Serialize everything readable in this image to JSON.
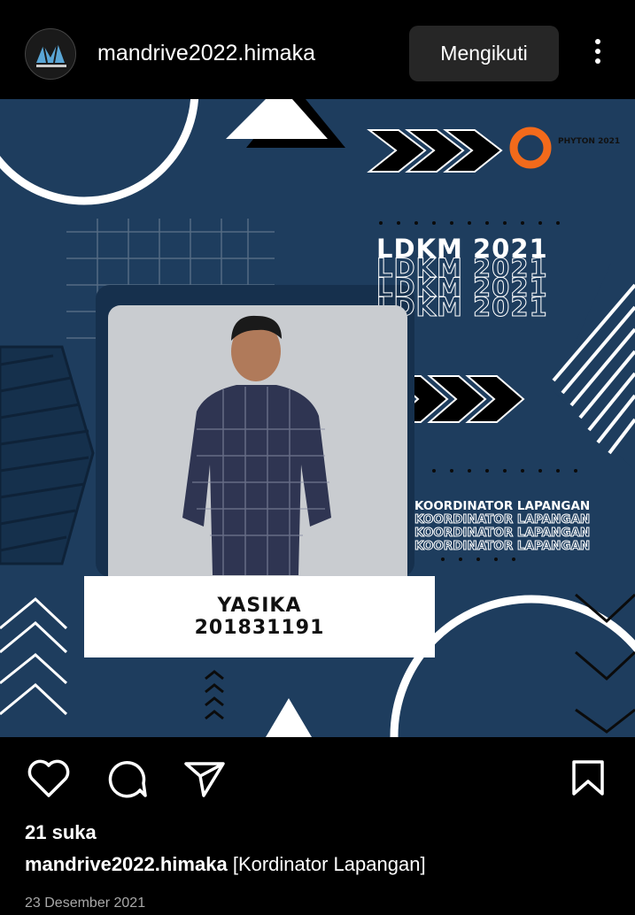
{
  "header": {
    "username": "mandrive2022.himaka",
    "follow_label": "Mengikuti"
  },
  "post": {
    "logo_text": "PHYTON 2021",
    "event_title": "LDKM 2021",
    "role": "KOORDINATOR LAPANGAN",
    "person_name": "YASIKA",
    "person_id": "201831191"
  },
  "footer": {
    "likes": "21 suka",
    "caption_user": "mandrive2022.himaka",
    "caption_text": "[Kordinator Lapangan]",
    "date": "23 Desember 2021"
  },
  "colors": {
    "post_bg": "#1e3d5e",
    "accent": "#f26a1b"
  }
}
